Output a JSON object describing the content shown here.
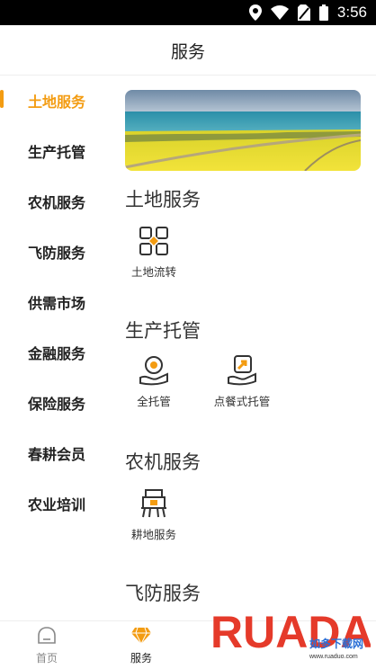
{
  "status_bar": {
    "time": "3:56"
  },
  "header": {
    "title": "服务"
  },
  "sidebar": {
    "items": [
      {
        "label": "土地服务",
        "active": true
      },
      {
        "label": "生产托管"
      },
      {
        "label": "农机服务"
      },
      {
        "label": "飞防服务"
      },
      {
        "label": "供需市场"
      },
      {
        "label": "金融服务"
      },
      {
        "label": "保险服务"
      },
      {
        "label": "春耕会员"
      },
      {
        "label": "农业培训"
      }
    ]
  },
  "sections": [
    {
      "title": "土地服务",
      "services": [
        {
          "label": "土地流转",
          "icon": "land-transfer-icon"
        }
      ]
    },
    {
      "title": "生产托管",
      "services": [
        {
          "label": "全托管",
          "icon": "full-custody-icon"
        },
        {
          "label": "点餐式托管",
          "icon": "menu-custody-icon"
        }
      ]
    },
    {
      "title": "农机服务",
      "services": [
        {
          "label": "耕地服务",
          "icon": "tractor-icon"
        }
      ]
    },
    {
      "title": "飞防服务",
      "services": []
    }
  ],
  "tabbar": {
    "tabs": [
      {
        "label": "首页",
        "icon": "home-icon"
      },
      {
        "label": "服务",
        "icon": "diamond-icon",
        "active": true
      }
    ]
  },
  "watermark": {
    "brand": "RUADAO",
    "tagline": "如多下载网",
    "url": "www.ruaduo.com"
  },
  "colors": {
    "accent": "#f39c12",
    "text": "#222222"
  }
}
